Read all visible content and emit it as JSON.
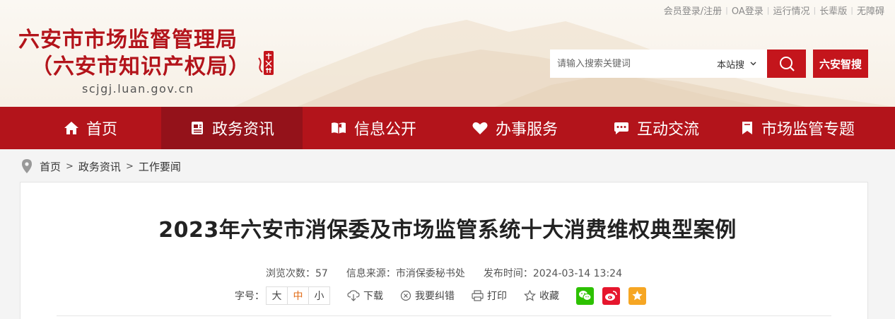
{
  "colors": {
    "brand_red": "#b3141b",
    "nav_active": "#94121a",
    "accent_orange": "#e26b16"
  },
  "toplinks": [
    {
      "label": "会员登录/注册",
      "icon": "none"
    },
    {
      "label": "OA登录",
      "icon": "none"
    },
    {
      "label": "运行情况",
      "icon": "none"
    },
    {
      "label": "长辈版",
      "icon": "none"
    },
    {
      "label": "无障碍",
      "icon": "none"
    }
  ],
  "header": {
    "title": "六安市市场监督管理局",
    "subtitle": "（六安市知识产权局）",
    "url": "scjgj.luan.gov.cn",
    "seal": "六安"
  },
  "search": {
    "placeholder": "请输入搜索关键词",
    "value": "",
    "scope": "本站搜",
    "button_icon": "search-icon",
    "smart_button": "六安智搜"
  },
  "nav": [
    {
      "label": "首页",
      "icon": "home-icon",
      "active": false
    },
    {
      "label": "政务资讯",
      "icon": "news-icon",
      "active": true
    },
    {
      "label": "信息公开",
      "icon": "open-book-icon",
      "active": false
    },
    {
      "label": "办事服务",
      "icon": "heart-hand-icon",
      "active": false
    },
    {
      "label": "互动交流",
      "icon": "chat-icon",
      "active": false
    },
    {
      "label": "市场监管专题",
      "icon": "bookmark-icon",
      "active": false
    }
  ],
  "breadcrumb": [
    "首页",
    "政务资讯",
    "工作要闻"
  ],
  "article": {
    "title": "2023年六安市消保委及市场监管系统十大消费维权典型案例",
    "meta": {
      "views": "浏览次数：57",
      "source": "信息来源：市消保委秘书处",
      "published": "发布时间：2024-03-14 13:24"
    },
    "font_size_label": "字号：",
    "font_sizes": [
      "大",
      "中",
      "小"
    ],
    "font_size_selected": "中",
    "tools": [
      {
        "label": "下载",
        "icon": "download-icon"
      },
      {
        "label": "我要纠错",
        "icon": "error-report-icon"
      },
      {
        "label": "打印",
        "icon": "print-icon"
      },
      {
        "label": "收藏",
        "icon": "star-outline-icon"
      }
    ],
    "share": [
      {
        "name": "wechat",
        "color": "#2dc100",
        "icon": "wechat-icon"
      },
      {
        "name": "weibo",
        "color": "#e6162d",
        "icon": "weibo-icon"
      },
      {
        "name": "favorite",
        "color": "#f6a623",
        "icon": "star-icon"
      }
    ]
  }
}
